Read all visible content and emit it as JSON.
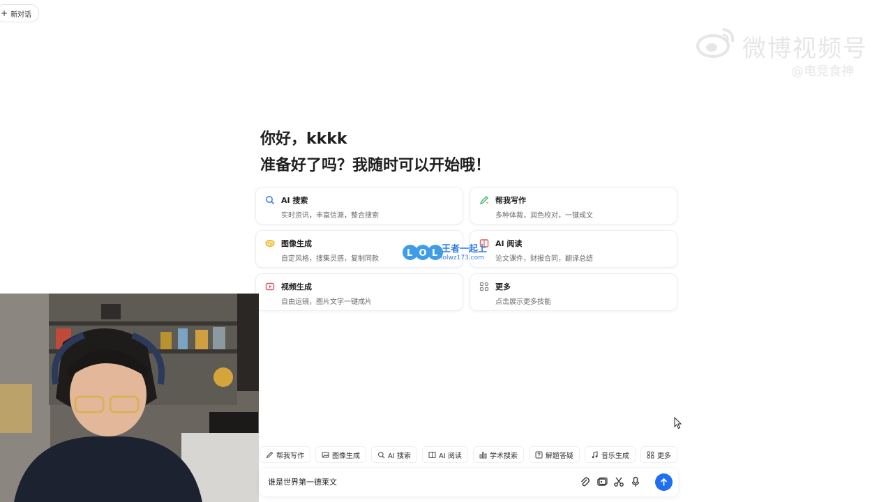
{
  "top": {
    "new_chat_label": "新对话"
  },
  "watermark": {
    "main": "微博视频号",
    "sub": "@电竞食神"
  },
  "greeting": {
    "hello": "你好，kkkk",
    "ready": "准备好了吗？我随时可以开始哦！"
  },
  "cards": [
    {
      "title": "AI 搜索",
      "desc": "实时资讯，丰富信源，整合搜索",
      "icon": "search-icon",
      "color": "#2f7de1"
    },
    {
      "title": "帮我写作",
      "desc": "多种体裁，润色校对，一键成文",
      "icon": "pen-icon",
      "color": "#3cb371"
    },
    {
      "title": "图像生成",
      "desc": "自定风格，搜集灵感，复制同款",
      "icon": "image-icon",
      "color": "#e6a91a"
    },
    {
      "title": "AI 阅读",
      "desc": "论文课件，财报合同，翻译总结",
      "icon": "book-icon",
      "color": "#e25d5d"
    },
    {
      "title": "视频生成",
      "desc": "自由运镜，图片文字一键成片",
      "icon": "video-icon",
      "color": "#e0506a"
    },
    {
      "title": "更多",
      "desc": "点击展示更多技能",
      "icon": "grid-icon",
      "color": "#888888"
    }
  ],
  "overlay_logo": {
    "letters": "LOL",
    "cn": "王者一起上",
    "domain": "lolwz173.com"
  },
  "quickbar": [
    {
      "label": "帮我写作",
      "icon": "pen-icon"
    },
    {
      "label": "图像生成",
      "icon": "image-icon"
    },
    {
      "label": "AI 搜索",
      "icon": "search-icon"
    },
    {
      "label": "AI 阅读",
      "icon": "book-icon"
    },
    {
      "label": "学术搜索",
      "icon": "chart-icon"
    },
    {
      "label": "解题答疑",
      "icon": "question-icon"
    },
    {
      "label": "音乐生成",
      "icon": "music-icon"
    },
    {
      "label": "更多",
      "icon": "grid-icon"
    }
  ],
  "input": {
    "value": "谁是世界第一德莱文"
  },
  "colors": {
    "accent": "#1f6ff2"
  }
}
